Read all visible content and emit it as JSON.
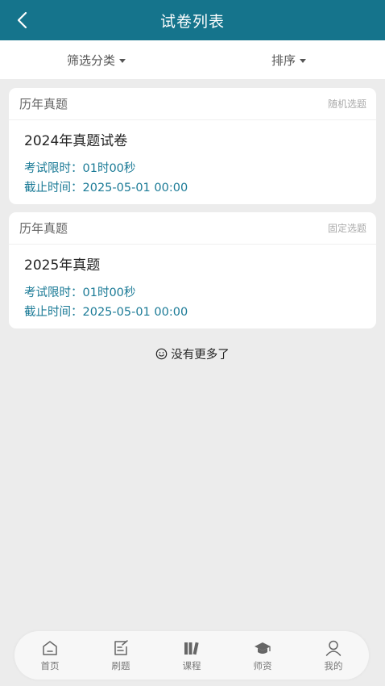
{
  "header": {
    "title": "试卷列表"
  },
  "filters": {
    "category": "筛选分类",
    "sort": "排序"
  },
  "papers": [
    {
      "category": "历年真题",
      "mode": "随机选题",
      "title": "2024年真题试卷",
      "duration_label": "考试限时：",
      "duration": "01时00秒",
      "deadline_label": "截止时间：",
      "deadline": "2025-05-01 00:00"
    },
    {
      "category": "历年真题",
      "mode": "固定选题",
      "title": "2025年真题",
      "duration_label": "考试限时：",
      "duration": "01时00秒",
      "deadline_label": "截止时间：",
      "deadline": "2025-05-01 00:00"
    }
  ],
  "footer": {
    "no_more": "没有更多了"
  },
  "tabbar": {
    "items": [
      {
        "label": "首页",
        "icon": "home-icon"
      },
      {
        "label": "刷题",
        "icon": "edit-icon"
      },
      {
        "label": "课程",
        "icon": "books-icon"
      },
      {
        "label": "师资",
        "icon": "graduation-cap-icon"
      },
      {
        "label": "我的",
        "icon": "user-icon"
      }
    ]
  },
  "colors": {
    "primary": "#15748c",
    "accent_text": "#1a7a96",
    "background": "#ececec"
  }
}
